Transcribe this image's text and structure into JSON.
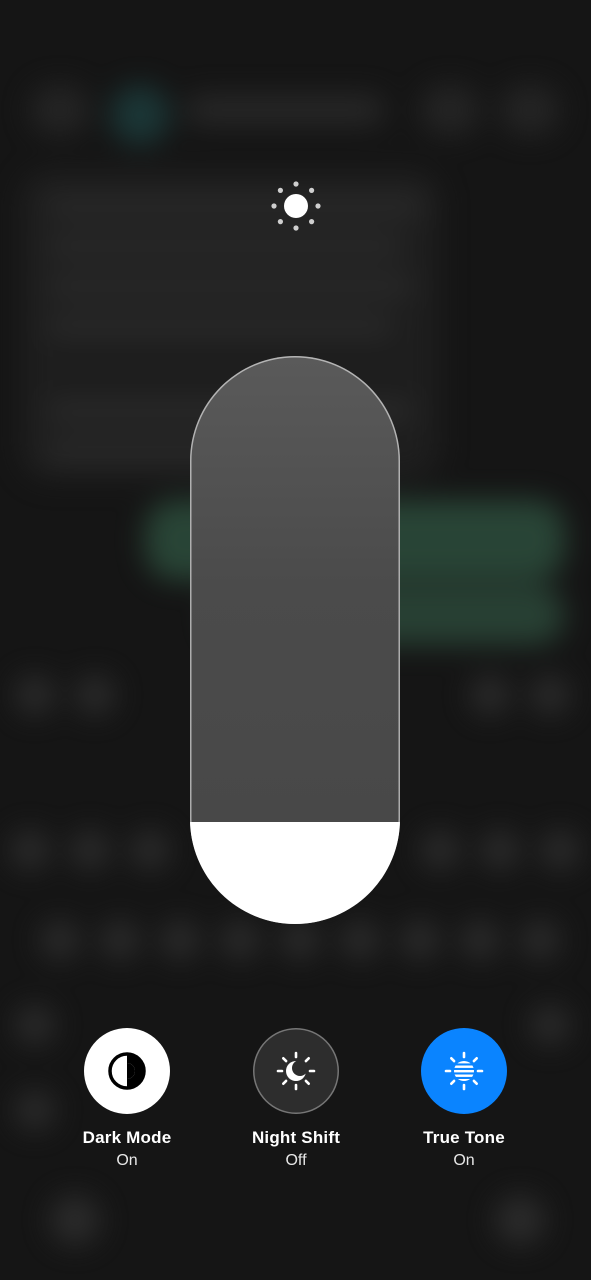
{
  "brightness": {
    "level": 0.18,
    "icon": "sun-icon"
  },
  "controls": [
    {
      "label": "Dark Mode",
      "state": "On",
      "icon": "dark-mode-icon",
      "active": true
    },
    {
      "label": "Night Shift",
      "state": "Off",
      "icon": "night-shift-icon",
      "active": false
    },
    {
      "label": "True Tone",
      "state": "On",
      "icon": "true-tone-icon",
      "active": true
    }
  ],
  "colors": {
    "accent": "#0a84ff",
    "background": "#151515",
    "slider_fill": "#ffffff"
  }
}
